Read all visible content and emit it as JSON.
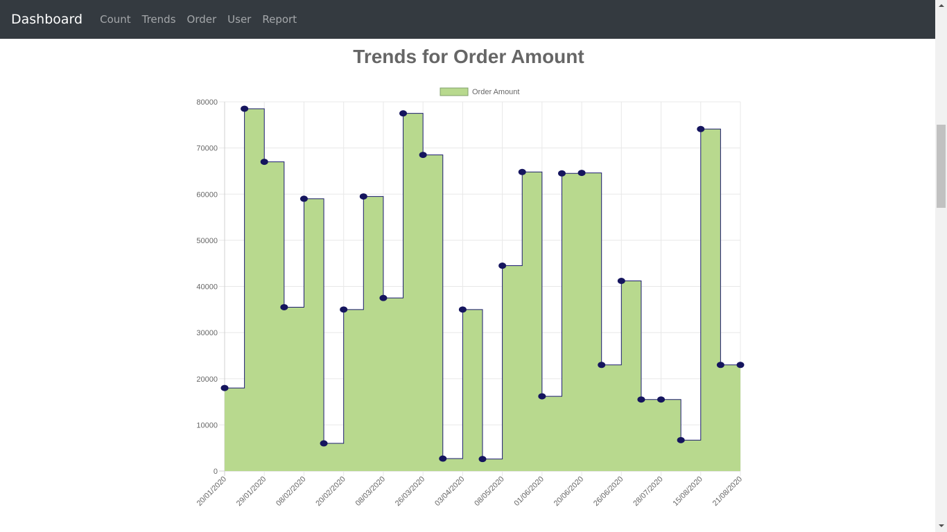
{
  "navbar": {
    "brand": "Dashboard",
    "links": [
      "Count",
      "Trends",
      "Order",
      "User",
      "Report"
    ],
    "background": "#343a40"
  },
  "chart_data": {
    "type": "line",
    "stepped": true,
    "filled": true,
    "title": "Trends for Order Amount",
    "xlabel": "",
    "ylabel": "",
    "ylim": [
      0,
      80000
    ],
    "yticks": [
      0,
      10000,
      20000,
      30000,
      40000,
      50000,
      60000,
      70000,
      80000
    ],
    "grid": true,
    "legend_position": "top",
    "x": [
      "20/01/2020",
      "",
      "29/01/2020",
      "",
      "08/02/2020",
      "",
      "20/02/2020",
      "",
      "08/03/2020",
      "",
      "26/03/2020",
      "",
      "03/04/2020",
      "",
      "08/05/2020",
      "",
      "01/06/2020",
      "",
      "20/06/2020",
      "",
      "26/06/2020",
      "",
      "28/07/2020",
      "",
      "15/08/2020",
      "",
      "21/08/2020"
    ],
    "series": [
      {
        "name": "Order Amount",
        "fill_color": "#b8d98e",
        "line_color": "#1a1a6e",
        "point_color": "#15155e",
        "values": [
          18000,
          78500,
          67000,
          35500,
          59000,
          6000,
          35000,
          59500,
          37500,
          77500,
          68500,
          2700,
          35000,
          2600,
          44500,
          64800,
          16200,
          64500,
          64600,
          23000,
          41200,
          15500,
          15500,
          6700,
          74100,
          23000,
          23000
        ]
      }
    ]
  }
}
